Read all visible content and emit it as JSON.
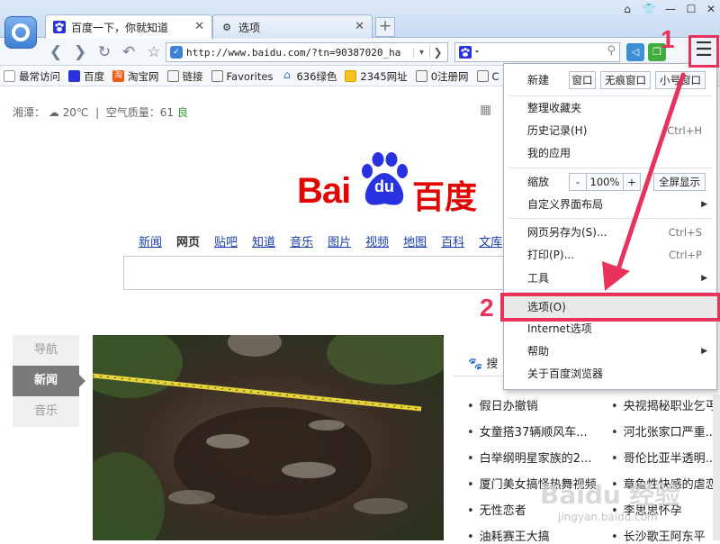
{
  "tabs": [
    {
      "label": "百度一下，你就知道",
      "icon": "baidu-paw-icon",
      "active": true
    },
    {
      "label": "选项",
      "icon": "gear-icon",
      "active": false
    }
  ],
  "address": {
    "url": "http://www.baidu.com/?tn=90387020_ha"
  },
  "bookmarks": [
    "最常访问",
    "百度",
    "淘宝网",
    "链接",
    "Favorites",
    "636绿色",
    "2345网址",
    "0注册网",
    "C"
  ],
  "page": {
    "weather": {
      "city": "湘潭：",
      "temp": "20℃",
      "sep": "|",
      "aqi_label": "空气质量：61",
      "aqi_level": "良"
    },
    "logo_text": {
      "bai": "Bai",
      "du": "du",
      "cn": "百度"
    },
    "nav_links": [
      "新闻",
      "网页",
      "贴吧",
      "知道",
      "音乐",
      "图片",
      "视频",
      "地图",
      "百科",
      "文库"
    ],
    "sidenav": [
      "导航",
      "新闻",
      "音乐"
    ],
    "news_header": "搜",
    "news_left": [
      "假日办撤销",
      "女童搭37辆顺风车...",
      "白举纲明星家族的2...",
      "厦门美女搞怪热舞视频",
      "无性恋者",
      "油耗赛王大搞"
    ],
    "news_right": [
      "央视揭秘职业乞丐",
      "河北张家口严重...",
      "哥伦比亚半透明...",
      "章鱼性快感的虐恋",
      "李思思怀孕",
      "长沙歌王阿东平"
    ]
  },
  "menu": {
    "new_label": "新建",
    "new_buttons": [
      "窗口",
      "无痕窗口",
      "小号窗口"
    ],
    "bookmarks": "整理收藏夹",
    "history": {
      "label": "历史记录(H)",
      "shortcut": "Ctrl+H"
    },
    "apps": "我的应用",
    "zoom": {
      "label": "缩放",
      "minus": "-",
      "value": "100%",
      "plus": "+",
      "fullscreen": "全屏显示"
    },
    "custom_layout": "自定义界面布局",
    "save_as": {
      "label": "网页另存为(S)...",
      "shortcut": "Ctrl+S"
    },
    "print": {
      "label": "打印(P)...",
      "shortcut": "Ctrl+P"
    },
    "tools": "工具",
    "options": "选项(O)",
    "internet_options": "Internet选项",
    "help": "帮助",
    "about": "关于百度浏览器"
  },
  "callouts": {
    "one": "1",
    "two": "2"
  },
  "watermark": {
    "main": "Baidu 经验",
    "sub": "jingyan.baidu.com"
  },
  "colors": {
    "accent_red": "#e8325a",
    "baidu_red": "#e10601",
    "baidu_blue": "#2932e1",
    "link_blue": "#1a3fa8"
  }
}
